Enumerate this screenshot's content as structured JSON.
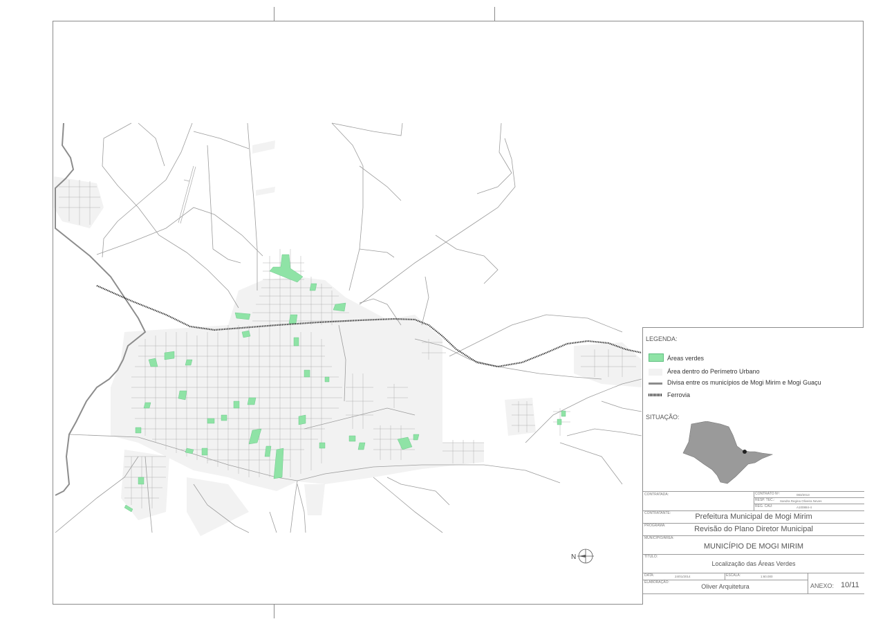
{
  "legend": {
    "heading": "LEGENDA:",
    "items": [
      {
        "label": "Áreas verdes",
        "symbol": "green-area-icon"
      },
      {
        "label": "Área dentro do Perímetro Urbano",
        "symbol": "urban-perimeter-icon"
      },
      {
        "label": "Divisa entre os municípios de Mogi Mirim e Mogi Guaçu",
        "symbol": "municipal-border-icon"
      },
      {
        "label": "Ferrovia",
        "symbol": "railway-icon"
      }
    ]
  },
  "situation": {
    "heading": "SITUAÇÃO:"
  },
  "title_block": {
    "contratada_label": "CONTRATADA:",
    "contrato_label": "CONTRATO Nº:",
    "contrato_value": "083/2013",
    "resp_tec_label": "RESP. TEC.:",
    "resp_tec_value": "Sandra Regina Oliveira Neves",
    "reg_cau_label": "REG. CAU:",
    "reg_cau_value": "A100884-4",
    "contratante_label": "CONTRATANTE:",
    "contratante_value": "Prefeitura Municipal de Mogi Mirim",
    "programa_label": "PROGRAMA:",
    "programa_value": "Revisão do Plano Diretor Municipal",
    "municipio_label": "MUNICÍPIO/ÁREA:",
    "municipio_value": "MUNICÍPIO DE MOGI MIRIM",
    "titulo_label": "TÍTULO:",
    "titulo_value": "Localização das Áreas Verdes",
    "data_label": "DATA:",
    "data_value": "24/01/2014",
    "escala_label": "ESCALA:",
    "escala_value": "1:60.000",
    "elaboracao_label": "ELABORAÇÃO:",
    "elaboracao_value": "Oliver Arquitetura",
    "anexo_label": "ANEXO:",
    "anexo_value": "10/11"
  },
  "north_arrow": {
    "letter": "N",
    "symbol": "north-arrow-icon"
  },
  "colors": {
    "green_area": "#8fe3a6",
    "urban_area": "#f2f2f2",
    "roads": "#9b9b9b",
    "municipal_border": "#8c8c8c",
    "railway": "#1a1a1a",
    "state_map": "#9a9a9a"
  }
}
